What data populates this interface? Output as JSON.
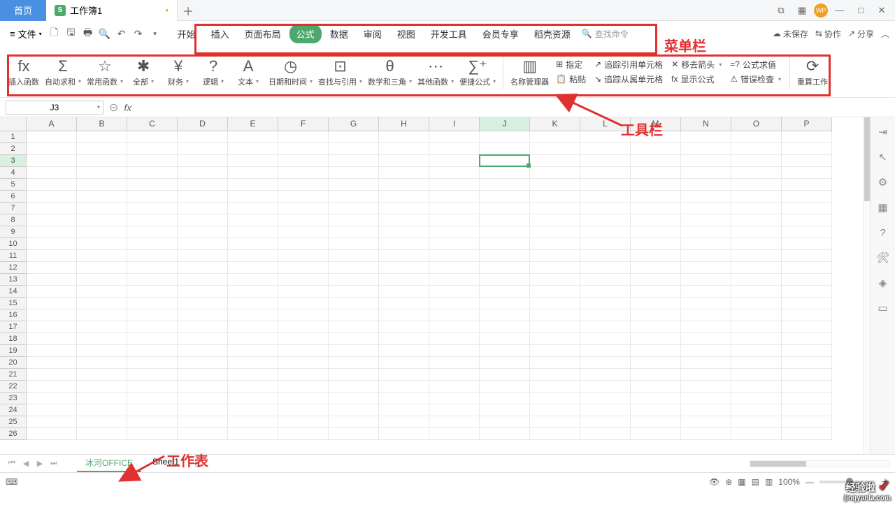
{
  "titlebar": {
    "home": "首页",
    "doc_title": "工作簿1",
    "wp_badge": "WP"
  },
  "menubar": {
    "file": "文件",
    "tabs": [
      "开始",
      "插入",
      "页面布局",
      "公式",
      "数据",
      "审阅",
      "视图",
      "开发工具",
      "会员专享",
      "稻壳资源"
    ],
    "active_index": 3,
    "search": "查找命令",
    "unsaved": "未保存",
    "collab": "协作",
    "share": "分享"
  },
  "ribbon": {
    "items": [
      {
        "icon": "fx",
        "label": "插入函数"
      },
      {
        "icon": "Σ",
        "label": "自动求和",
        "drop": true
      },
      {
        "icon": "☆",
        "label": "常用函数",
        "drop": true
      },
      {
        "icon": "✱",
        "label": "全部",
        "drop": true
      },
      {
        "icon": "¥",
        "label": "财务",
        "drop": true
      },
      {
        "icon": "?",
        "label": "逻辑",
        "drop": true
      },
      {
        "icon": "A",
        "label": "文本",
        "drop": true
      },
      {
        "icon": "◷",
        "label": "日期和时间",
        "drop": true
      },
      {
        "icon": "⊡",
        "label": "查找与引用",
        "drop": true
      },
      {
        "icon": "θ",
        "label": "数学和三角",
        "drop": true
      },
      {
        "icon": "⋯",
        "label": "其他函数",
        "drop": true
      },
      {
        "icon": "∑⁺",
        "label": "便捷公式",
        "drop": true
      }
    ],
    "name_mgr": "名称管理器",
    "assign": "指定",
    "paste": "粘贴",
    "trace_prec": "追踪引用单元格",
    "trace_dep": "追踪从属单元格",
    "remove_arrows": "移去箭头",
    "show_formula": "显示公式",
    "formula_eval": "公式求值",
    "error_check": "错误检查",
    "recalc": "重算工作"
  },
  "formula": {
    "name_box": "J3",
    "fx_prefix": "fx"
  },
  "grid": {
    "cols": [
      "A",
      "B",
      "C",
      "D",
      "E",
      "F",
      "G",
      "H",
      "I",
      "J",
      "K",
      "L",
      "M",
      "N",
      "O",
      "P"
    ],
    "rows": 26,
    "active_col_idx": 9,
    "active_row": 3
  },
  "sheets": {
    "list": [
      "冰河OFFICE",
      "Sheet1"
    ],
    "active": 0
  },
  "status": {
    "zoom": "100%"
  },
  "annotations": {
    "menubar_label": "菜单栏",
    "toolbar_label": "工具栏",
    "sheet_label": "工作表"
  },
  "watermark": {
    "brand": "经验啦",
    "url": "jingyanla.com"
  }
}
